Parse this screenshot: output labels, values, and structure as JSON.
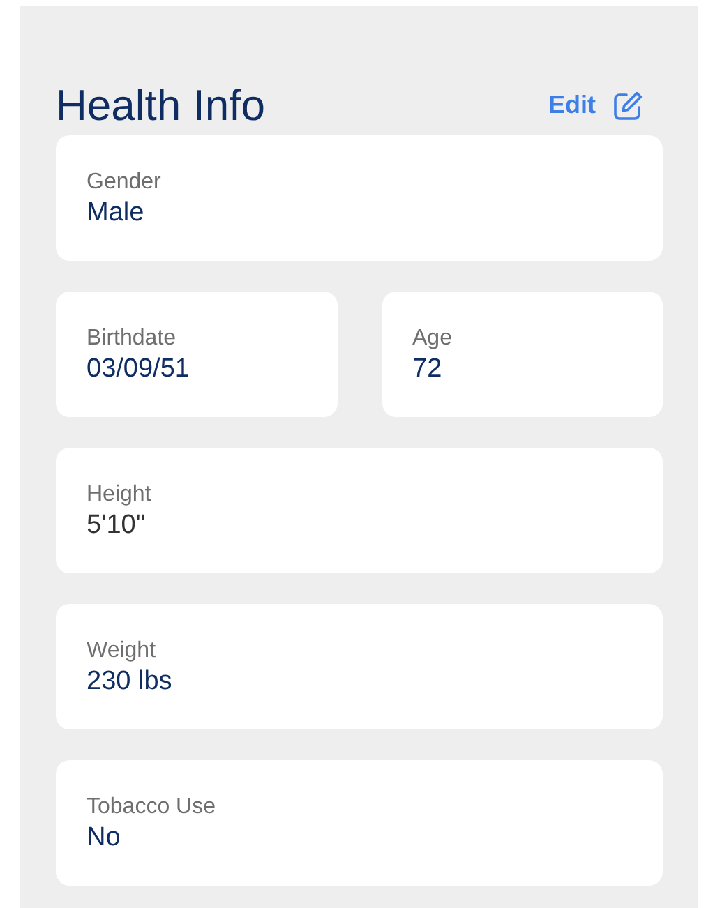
{
  "header": {
    "title": "Health Info",
    "edit_label": "Edit"
  },
  "rows": [
    {
      "fields": [
        {
          "label": "Gender",
          "value": "Male",
          "color": "#0f2d62"
        }
      ]
    },
    {
      "fields": [
        {
          "label": "Birthdate",
          "value": "03/09/51",
          "color": "#0f2d62"
        },
        {
          "label": "Age",
          "value": "72",
          "color": "#0f2d62"
        }
      ]
    },
    {
      "fields": [
        {
          "label": "Height",
          "value": "5'10\"",
          "color": "#333333"
        }
      ]
    },
    {
      "fields": [
        {
          "label": "Weight",
          "value": "230 lbs",
          "color": "#0f2d62"
        }
      ]
    },
    {
      "fields": [
        {
          "label": "Tobacco Use",
          "value": "No",
          "color": "#0f2d62"
        }
      ]
    }
  ]
}
